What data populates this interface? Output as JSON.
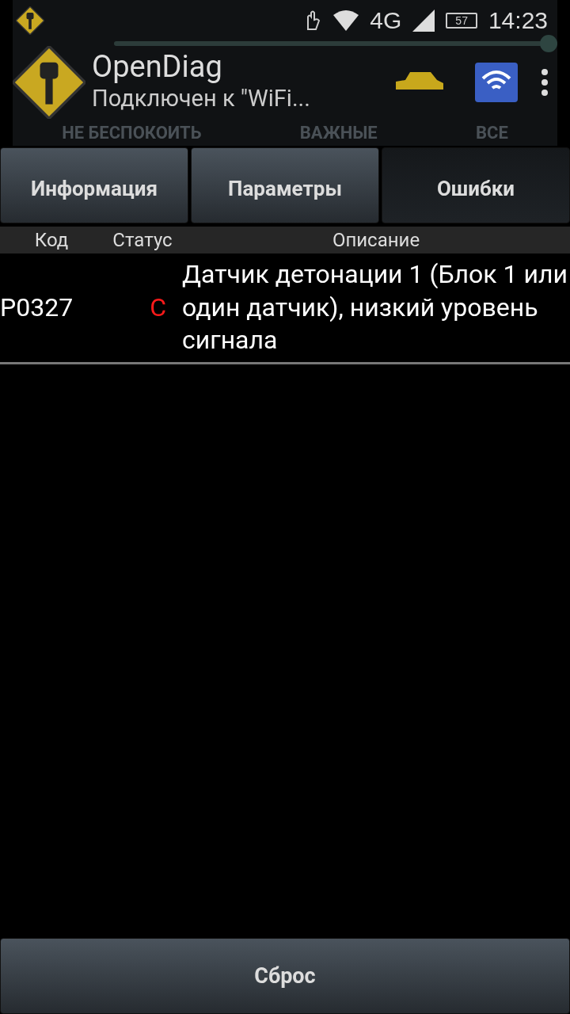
{
  "status_bar": {
    "network": "4G",
    "battery": "57",
    "time": "14:23"
  },
  "overlay": {
    "slider": {
      "level": 1.0
    },
    "modes": [
      {
        "label": "НЕ БЕСПОКОИТЬ",
        "selected": false
      },
      {
        "label": "ВАЖНЫЕ",
        "selected": false
      },
      {
        "label": "ВСЕ",
        "selected": false
      }
    ]
  },
  "app_bar": {
    "title": "OpenDiag",
    "subtitle": "Подключен к \"WiFi..."
  },
  "tabs": [
    {
      "label": "Информация",
      "selected": false
    },
    {
      "label": "Параметры",
      "selected": false
    },
    {
      "label": "Ошибки",
      "selected": true
    }
  ],
  "table": {
    "columns": [
      "Код",
      "Статус",
      "Описание"
    ],
    "rows": [
      {
        "code": "P0327",
        "status": "C",
        "color": "#ff1a1a",
        "description": "Датчик детонации 1 (Блок 1 или один датчик), низкий уровень сигнала"
      }
    ]
  },
  "reset_button": "Сброс"
}
